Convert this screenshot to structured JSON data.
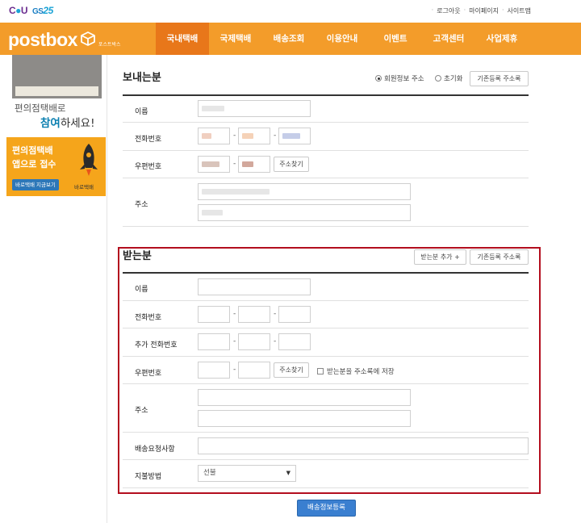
{
  "topbar": {
    "brand_cu": "C",
    "brand_o": "●",
    "brand_u": "U",
    "brand_gs": "GS",
    "brand_25": "25",
    "links": [
      "로그아웃",
      "마이페이지",
      "사이트맵"
    ]
  },
  "header": {
    "logo_text": "postbox",
    "logo_sub": "포스트박스",
    "nav": [
      "국내택배",
      "국제택배",
      "배송조회",
      "이용안내",
      "이벤트",
      "고객센터",
      "사업제휴"
    ],
    "active_nav": 0,
    "colors": {
      "header": "#f39c2a",
      "active": "#e8771a"
    }
  },
  "sidebar": {
    "promo1_line1": "편의점택배로",
    "promo1_line2_bold": "참여",
    "promo1_line2_rest": "하세요!",
    "promo2_line1": "편의점택배",
    "promo2_line2": "앱으로 접수",
    "promo2_button": "바로택배 지금보기",
    "promo2_app": "바로택배",
    "rocket_icon": "rocket-icon"
  },
  "sender": {
    "title": "보내는분",
    "radio_member": "회원정보 주소",
    "radio_reset": "초기화",
    "address_book_button": "기존등록 주소록",
    "labels": {
      "name": "이름",
      "phone": "전화번호",
      "postcode": "우편번호",
      "address": "주소"
    },
    "find_address_button": "주소찾기",
    "phone_separator": "-"
  },
  "receiver": {
    "title": "받는분",
    "add_receiver_button": "받는분 추가 +",
    "address_book_button": "기존등록 주소록",
    "labels": {
      "name": "이름",
      "phone": "전화번호",
      "extra_phone": "추가 전화번호",
      "postcode": "우편번호",
      "address": "주소",
      "request": "배송요청사항",
      "payment": "지불방법"
    },
    "find_address_button": "주소찾기",
    "save_to_book": "받는분을 주소록에 저장",
    "payment_value": "선불",
    "phone_separator": "-"
  },
  "submit_label": "배송정보등록",
  "highlight_color": "#b30e1e"
}
